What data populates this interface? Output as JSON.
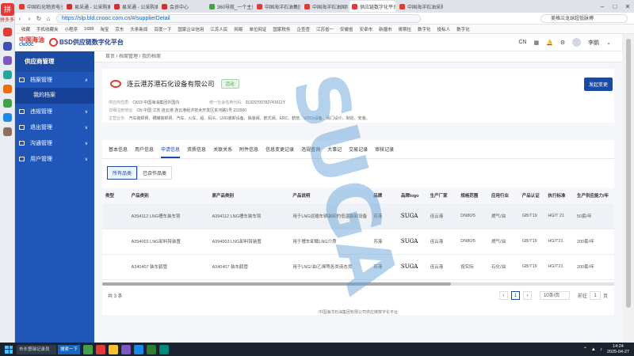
{
  "browser": {
    "side_logo_label": "拼多多",
    "tabs": [
      "中国石化物资电子招标投",
      "易采通 - 公采购更专业",
      "易采通 - 公采购更专业",
      "会员中心",
      "360导航_一个主页，整个",
      "中国海洋石油集团有限公司",
      "中国海洋石油国际有限公司",
      "供应链数字化平台-供应",
      "中国海洋石油采购信息化"
    ],
    "url": "https://slp.bld.cnooc.com.cn/#/supplierDetail",
    "search": "美格兰龙球超低脉搏",
    "bookmarks": [
      "收藏",
      "手机收藏夹",
      "小程序",
      "1688",
      "淘宝",
      "京东",
      "头条新闻",
      "百度一下",
      "国家企业信用",
      "江苏人民",
      "网易",
      "单位网证",
      "国家税务",
      "企查查",
      "江苏省一",
      "安徽省",
      "安卓市",
      "新疆市",
      "哥斯拉",
      "数字化",
      "投标人",
      "数字化"
    ]
  },
  "header": {
    "brand_cn": "中国海油",
    "brand_en": "CNOOC",
    "platform": "BSD供应链数字化平台",
    "lang": "CN",
    "user": "李鹏"
  },
  "sidebar": {
    "title": "供应商管理",
    "items": [
      {
        "label": "档案管理",
        "expanded": true
      },
      {
        "label": "我的档案",
        "sub": true
      },
      {
        "label": "违规管理"
      },
      {
        "label": "退出管理"
      },
      {
        "label": "沟通管理"
      },
      {
        "label": "用户管理"
      }
    ]
  },
  "breadcrumb": "首页 / 档案管理 / 我的档案",
  "company": {
    "name": "连云港苏港石化设备有限公司",
    "status": "活动",
    "button": "发起变更",
    "info": [
      {
        "k": "供应商性质:",
        "v": "CK03 中国海油集团外国内"
      },
      {
        "k": "统一社会信用代码:",
        "v": "91320700782741611Y"
      },
      {
        "k": "详细注册地址:",
        "v": "CN 中国 江苏 连云港 连云港经济技术开发区夹河路1号 222000"
      },
      {
        "k": "主营业务:",
        "v": "汽车装卸臂、槽罐装卸臂、汽车、火车、船、码头、LNG装卸设备、撬装阀、鹤式阀、ERC、鹤管、VOCs设备、阀门设计、制造、安装。"
      }
    ]
  },
  "tabs": [
    "基本信息",
    "用户信息",
    "申请信息",
    "资质信息",
    "关联关系",
    "附件信息",
    "信息变更记录",
    "违规查询",
    "大事记",
    "交易记录",
    "审核记录"
  ],
  "active_tab": 2,
  "subtabs": [
    "所有品类",
    "已合作品类"
  ],
  "table": {
    "headers": [
      "类型",
      "产品类别",
      "原产品类别",
      "产品说明",
      "品牌",
      "品牌logo",
      "生产厂家",
      "规格范围",
      "应用行业",
      "产品认证",
      "执行标准",
      "生产供应能力/年"
    ],
    "rows": [
      [
        "",
        "A394112 LNG槽车装车臂",
        "A394112 LNG槽车装车臂",
        "用于LNG运输车辆装卸的低温装卸设备",
        "苏港",
        "SUGA",
        "连云港",
        "DN80/5",
        "燃气/油",
        "GB/T19",
        "HG/T 21",
        "50套/年"
      ],
      [
        "",
        "A394003 LNG卸料臂装置",
        "A394003 LNG卸料臂装置",
        "用于槽车卸载LNG介质",
        "苏港",
        "SUGA",
        "连云港",
        "DN80/5",
        "燃气/油",
        "GB/T19",
        "HG/T21",
        "200套/年"
      ],
      [
        "",
        "A340407 装车鹤管",
        "A340407 装车鹤管",
        "用于LNG/油/乙烯等各类液态货",
        "苏港",
        "SUGA",
        "连云港",
        "按实际",
        "石化/油",
        "GB/T19",
        "HG/T21",
        "200套/年"
      ]
    ],
    "highlight_row": 0
  },
  "pager": {
    "total": "共 3 条",
    "page": "1",
    "size": "10条/页",
    "goto": "前往",
    "goto_val": "1",
    "unit": "页"
  },
  "footer": "中国海洋石油集团有限公司供应链数字化平台",
  "taskbar": {
    "search": "市长督瑞记录员",
    "search_btn": "搜索一下",
    "time": "14:24",
    "date": "2025-04-27"
  },
  "watermark": "SUGA"
}
